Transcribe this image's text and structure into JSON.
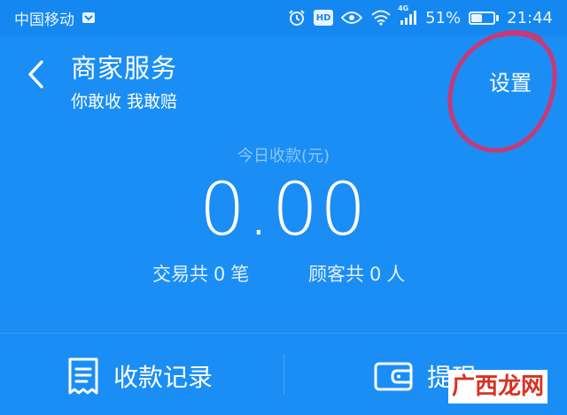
{
  "status_bar": {
    "carrier": "中国移动",
    "network_type": "4G",
    "battery_percent": "51%",
    "battery_level": 0.51,
    "time": "21:44",
    "hd_label": "HD"
  },
  "header": {
    "title": "商家服务",
    "subtitle": "你敢收 我敢赔",
    "settings_label": "设置"
  },
  "summary": {
    "income_label": "今日收款(元)",
    "amount": "0.00",
    "transactions_prefix": "交易共",
    "transactions_count": "0",
    "transactions_unit": "笔",
    "customers_prefix": "顾客共",
    "customers_count": "0",
    "customers_unit": "人"
  },
  "actions": {
    "records_label": "收款记录",
    "withdraw_label": "提现"
  },
  "watermark": {
    "text": "广西龙网"
  },
  "icons": {
    "back": "chevron-left-icon",
    "records": "receipt-icon",
    "withdraw": "wallet-icon",
    "alarm": "alarm-icon",
    "eye": "eye-icon",
    "wifi": "wifi-icon",
    "signal": "signal-icon",
    "battery": "battery-icon",
    "carrier_badge": "carrier-badge-icon"
  },
  "colors": {
    "background": "#1a8ef5",
    "status_bar": "#1488f0",
    "annotation": "#c63a77",
    "watermark_text": "#d73222"
  }
}
